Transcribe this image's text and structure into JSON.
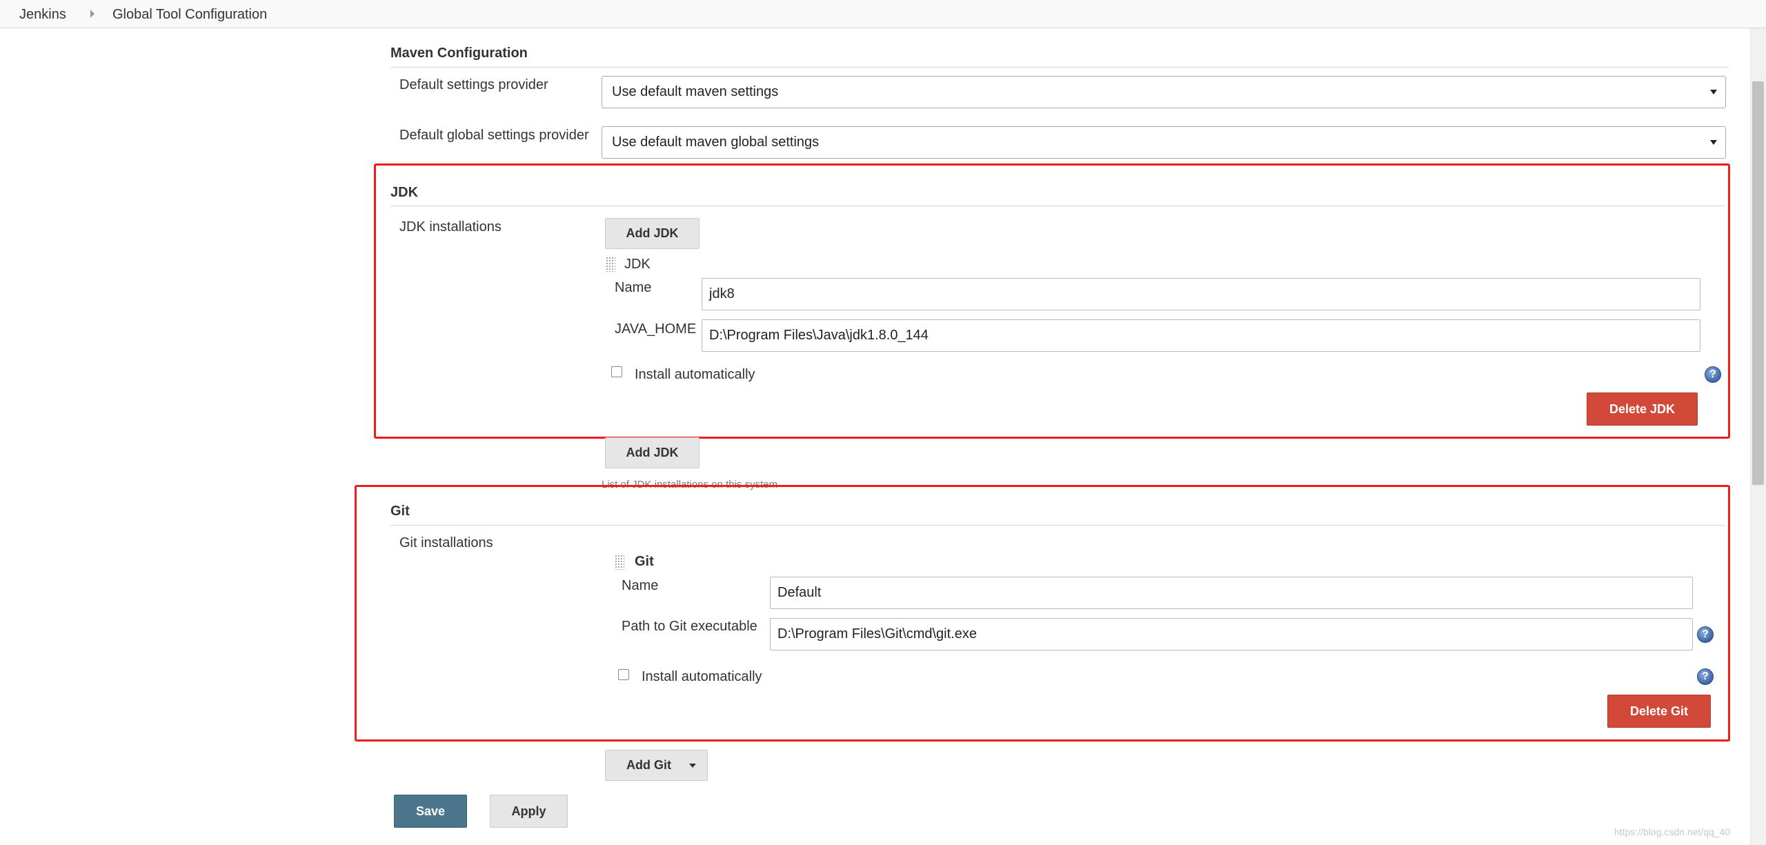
{
  "breadcrumb": {
    "items": [
      "Jenkins",
      "Global Tool Configuration"
    ]
  },
  "maven": {
    "title": "Maven Configuration",
    "default_settings_label": "Default settings provider",
    "default_settings_value": "Use default maven settings",
    "default_global_label": "Default global settings provider",
    "default_global_value": "Use default maven global settings"
  },
  "jdk": {
    "title": "JDK",
    "installations_label": "JDK installations",
    "add_button": "Add JDK",
    "item_title": "JDK",
    "name_label": "Name",
    "name_value": "jdk8",
    "home_label": "JAVA_HOME",
    "home_value": "D:\\Program Files\\Java\\jdk1.8.0_144",
    "install_auto_label": "Install automatically",
    "delete_button": "Delete JDK",
    "hint": "List of JDK installations on this system"
  },
  "git": {
    "title": "Git",
    "installations_label": "Git installations",
    "item_title": "Git",
    "name_label": "Name",
    "name_value": "Default",
    "path_label": "Path to Git executable",
    "path_value": "D:\\Program Files\\Git\\cmd\\git.exe",
    "install_auto_label": "Install automatically",
    "delete_button": "Delete Git",
    "add_button": "Add Git"
  },
  "actions": {
    "save": "Save",
    "apply": "Apply"
  },
  "watermark": "https://blog.csdn.net/qq_40"
}
